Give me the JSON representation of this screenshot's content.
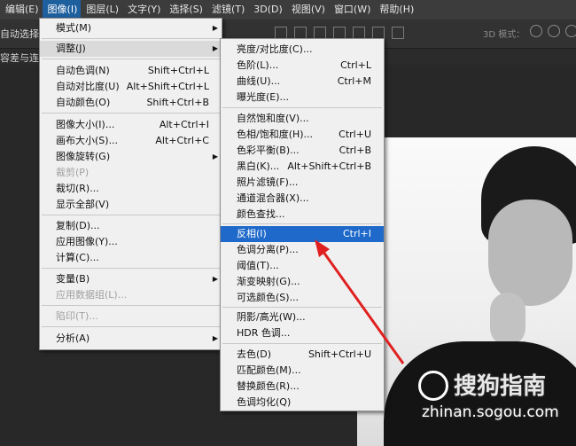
{
  "menubar": [
    {
      "label": "编辑(E)",
      "active": false
    },
    {
      "label": "图像(I)",
      "active": true
    },
    {
      "label": "图层(L)",
      "active": false
    },
    {
      "label": "文字(Y)",
      "active": false
    },
    {
      "label": "选择(S)",
      "active": false
    },
    {
      "label": "滤镜(T)",
      "active": false
    },
    {
      "label": "3D(D)",
      "active": false
    },
    {
      "label": "视图(V)",
      "active": false
    },
    {
      "label": "窗口(W)",
      "active": false
    },
    {
      "label": "帮助(H)",
      "active": false
    }
  ],
  "options_bar": {
    "auto_select": "自动选择：",
    "mode_3d": "3D 模式："
  },
  "tab": {
    "label": "容差与连续"
  },
  "image_menu": {
    "mode": "模式(M)",
    "adjust": "调整(J)",
    "auto_tone": {
      "label": "自动色调(N)",
      "shortcut": "Shift+Ctrl+L"
    },
    "auto_contrast": {
      "label": "自动对比度(U)",
      "shortcut": "Alt+Shift+Ctrl+L"
    },
    "auto_color": {
      "label": "自动颜色(O)",
      "shortcut": "Shift+Ctrl+B"
    },
    "image_size": {
      "label": "图像大小(I)...",
      "shortcut": "Alt+Ctrl+I"
    },
    "canvas_size": {
      "label": "画布大小(S)...",
      "shortcut": "Alt+Ctrl+C"
    },
    "rotate": "图像旋转(G)",
    "crop_disabled": "裁剪(P)",
    "trim": "裁切(R)...",
    "reveal_all": "显示全部(V)",
    "duplicate": "复制(D)...",
    "apply_image": "应用图像(Y)...",
    "calculations": "计算(C)...",
    "variables": "变量(B)",
    "apply_dataset": "应用数据组(L)...",
    "trap": "陷印(T)...",
    "analysis": "分析(A)"
  },
  "adjust_menu": {
    "brightness": {
      "label": "亮度/对比度(C)...",
      "shortcut": ""
    },
    "levels": {
      "label": "色阶(L)...",
      "shortcut": "Ctrl+L"
    },
    "curves": {
      "label": "曲线(U)...",
      "shortcut": "Ctrl+M"
    },
    "exposure": {
      "label": "曝光度(E)...",
      "shortcut": ""
    },
    "vibrance": {
      "label": "自然饱和度(V)...",
      "shortcut": ""
    },
    "hue_sat": {
      "label": "色相/饱和度(H)...",
      "shortcut": "Ctrl+U"
    },
    "color_balance": {
      "label": "色彩平衡(B)...",
      "shortcut": "Ctrl+B"
    },
    "bw": {
      "label": "黑白(K)...",
      "shortcut": "Alt+Shift+Ctrl+B"
    },
    "photo_filter": {
      "label": "照片滤镜(F)...",
      "shortcut": ""
    },
    "channel_mixer": {
      "label": "通道混合器(X)...",
      "shortcut": ""
    },
    "color_lookup": {
      "label": "颜色查找...",
      "shortcut": ""
    },
    "invert": {
      "label": "反相(I)",
      "shortcut": "Ctrl+I"
    },
    "posterize": {
      "label": "色调分离(P)...",
      "shortcut": ""
    },
    "threshold": {
      "label": "阈值(T)...",
      "shortcut": ""
    },
    "gradient_map": {
      "label": "渐变映射(G)...",
      "shortcut": ""
    },
    "selective_color": {
      "label": "可选颜色(S)...",
      "shortcut": ""
    },
    "shadows_highlights": {
      "label": "阴影/高光(W)...",
      "shortcut": ""
    },
    "hdr_toning": {
      "label": "HDR 色调...",
      "shortcut": ""
    },
    "desaturate": {
      "label": "去色(D)",
      "shortcut": "Shift+Ctrl+U"
    },
    "match_color": {
      "label": "匹配颜色(M)...",
      "shortcut": ""
    },
    "replace_color": {
      "label": "替换颜色(R)...",
      "shortcut": ""
    },
    "equalize": {
      "label": "色调均化(Q)",
      "shortcut": ""
    }
  },
  "watermark": {
    "text": "搜狗指南",
    "url": "zhinan.sogou.com"
  },
  "colors": {
    "highlight": "#1e69c9",
    "arrow": "#e02020"
  }
}
